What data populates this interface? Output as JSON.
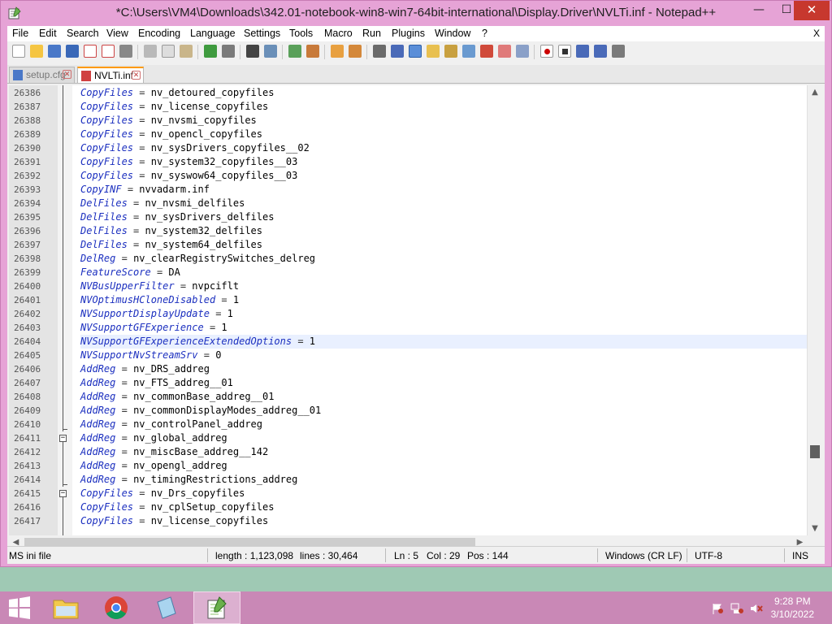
{
  "window": {
    "title": "*C:\\Users\\VM4\\Downloads\\342.01-notebook-win8-win7-64bit-international\\Display.Driver\\NVLTi.inf - Notepad++",
    "minimize": "—",
    "maximize": "☐",
    "close": "✕"
  },
  "menu": {
    "items": [
      "File",
      "Edit",
      "Search",
      "View",
      "Encoding",
      "Language",
      "Settings",
      "Tools",
      "Macro",
      "Run",
      "Plugins",
      "Window",
      "?"
    ],
    "close_label": "X"
  },
  "tabs": [
    {
      "label": "setup.cfg"
    },
    {
      "label": "NVLTi.inf"
    }
  ],
  "editor": {
    "lines": [
      {
        "n": "26386",
        "key": "CopyFiles",
        "val": "nv_detoured_copyfiles"
      },
      {
        "n": "26387",
        "key": "CopyFiles",
        "val": "nv_license_copyfiles"
      },
      {
        "n": "26388",
        "key": "CopyFiles",
        "val": "nv_nvsmi_copyfiles"
      },
      {
        "n": "26389",
        "key": "CopyFiles",
        "val": "nv_opencl_copyfiles"
      },
      {
        "n": "26390",
        "key": "CopyFiles",
        "val": "nv_sysDrivers_copyfiles__02"
      },
      {
        "n": "26391",
        "key": "CopyFiles",
        "val": "nv_system32_copyfiles__03"
      },
      {
        "n": "26392",
        "key": "CopyFiles",
        "val": "nv_syswow64_copyfiles__03"
      },
      {
        "n": "26393",
        "key": "CopyINF",
        "val": "nvvadarm.inf"
      },
      {
        "n": "26394",
        "key": "DelFiles",
        "val": "nv_nvsmi_delfiles"
      },
      {
        "n": "26395",
        "key": "DelFiles",
        "val": "nv_sysDrivers_delfiles"
      },
      {
        "n": "26396",
        "key": "DelFiles",
        "val": "nv_system32_delfiles"
      },
      {
        "n": "26397",
        "key": "DelFiles",
        "val": "nv_system64_delfiles"
      },
      {
        "n": "26398",
        "key": "DelReg",
        "val": "nv_clearRegistrySwitches_delreg"
      },
      {
        "n": "26399",
        "key": "FeatureScore",
        "val": "DA"
      },
      {
        "n": "26400",
        "key": "NVBusUpperFilter",
        "val": "nvpciflt"
      },
      {
        "n": "26401",
        "key": "NVOptimusHCloneDisabled",
        "val": "1"
      },
      {
        "n": "26402",
        "key": "NVSupportDisplayUpdate",
        "val": "1"
      },
      {
        "n": "26403",
        "key": "NVSupportGFExperience",
        "val": "1"
      },
      {
        "n": "26404",
        "key": "NVSupportGFExperienceExtendedOptions",
        "val": "1"
      },
      {
        "n": "26405",
        "key": "NVSupportNvStreamSrv",
        "val": "0"
      },
      {
        "n": "26406",
        "key": "AddReg",
        "val": "nv_DRS_addreg"
      },
      {
        "n": "26407",
        "key": "AddReg",
        "val": "nv_FTS_addreg__01"
      },
      {
        "n": "26408",
        "key": "AddReg",
        "val": "nv_commonBase_addreg__01"
      },
      {
        "n": "26409",
        "key": "AddReg",
        "val": "nv_commonDisplayModes_addreg__01"
      },
      {
        "n": "26410",
        "key": "AddReg",
        "val": "nv_controlPanel_addreg"
      },
      {
        "n": "26411",
        "key": "AddReg",
        "val": "nv_global_addreg"
      },
      {
        "n": "26412",
        "key": "AddReg",
        "val": "nv_miscBase_addreg__142"
      },
      {
        "n": "26413",
        "key": "AddReg",
        "val": "nv_opengl_addreg"
      },
      {
        "n": "26414",
        "key": "AddReg",
        "val": "nv_timingRestrictions_addreg"
      },
      {
        "n": "26415",
        "key": "CopyFiles",
        "val": "nv_Drs_copyfiles"
      },
      {
        "n": "26416",
        "key": "CopyFiles",
        "val": "nv_cplSetup_copyfiles"
      },
      {
        "n": "26417",
        "key": "CopyFiles",
        "val": "nv_license_copyfiles"
      }
    ],
    "operator": "="
  },
  "status": {
    "file_type": "MS ini file",
    "length": "length : 1,123,098",
    "lines": "lines : 30,464",
    "ln": "Ln : 5",
    "col": "Col : 29",
    "pos": "Pos : 144",
    "eol": "Windows (CR LF)",
    "encoding": "UTF-8",
    "mode": "INS"
  },
  "taskbar": {
    "time": "9:28 PM",
    "date": "3/10/2022"
  }
}
